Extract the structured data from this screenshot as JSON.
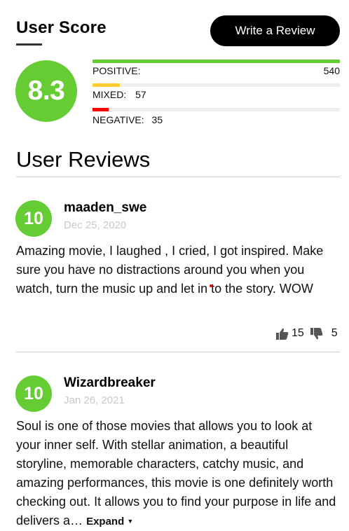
{
  "header": {
    "title": "User Score",
    "write_review_label": "Write a Review"
  },
  "score": {
    "value": "8.3",
    "color": "#66cc33"
  },
  "distribution": {
    "positive": {
      "label": "POSITIVE:",
      "count": "540",
      "fraction": 1.0,
      "color": "#66cc33"
    },
    "mixed": {
      "label": "MIXED:",
      "count": "57",
      "fraction": 0.11,
      "color": "#ffcc33"
    },
    "negative": {
      "label": "NEGATIVE:",
      "count": "35",
      "fraction": 0.065,
      "color": "#ff0000"
    }
  },
  "reviews_section": {
    "title": "User Reviews",
    "reviews": [
      {
        "score": "10",
        "user": "maaden_swe",
        "date": "Dec 25, 2020",
        "text": "Amazing movie, I laughed , I cried, I got inspired. Make sure you have no distractions around you when you watch, turn the music up and let in to the story. WOW",
        "thumbs_up": "15",
        "thumbs_down": "5"
      },
      {
        "score": "10",
        "user": "Wizardbreaker",
        "date": "Jan 26, 2021",
        "text": "Soul is one of those movies that allows you to look at your inner self. With stellar animation, a beautiful storyline, memorable characters, catchy music, and amazing performances, this movie is one definitely worth checking out. It allows you to find your purpose in life and delivers a…",
        "expand_label": "Expand"
      }
    ]
  },
  "icons": {
    "thumbs_up": "thumbs-up-icon",
    "thumbs_down": "thumbs-down-icon",
    "caret": "caret-down-icon"
  }
}
